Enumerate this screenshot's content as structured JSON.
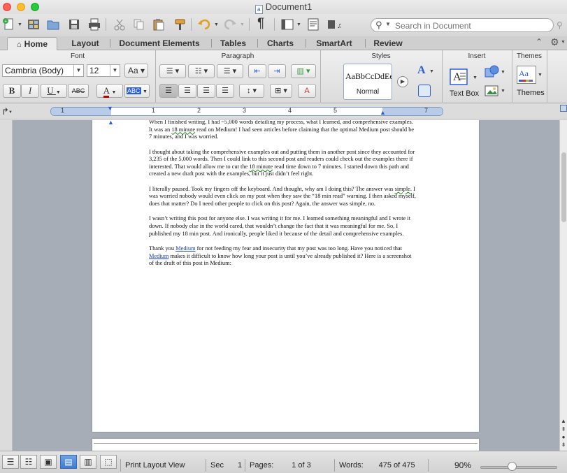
{
  "window": {
    "title": "Document1"
  },
  "search": {
    "placeholder": "Search in Document"
  },
  "tabs": [
    "Home",
    "Layout",
    "Document Elements",
    "Tables",
    "Charts",
    "SmartArt",
    "Review"
  ],
  "groups": {
    "font": "Font",
    "paragraph": "Paragraph",
    "styles": "Styles",
    "insert": "Insert",
    "themes": "Themes"
  },
  "font": {
    "family": "Cambria (Body)",
    "size": "12",
    "bold": "B",
    "italic": "I",
    "underline": "U",
    "strike": "ABC"
  },
  "styles": {
    "sample": "AaBbCcDdEe",
    "current": "Normal"
  },
  "insert": {
    "textbox_label": "Text Box"
  },
  "themes": {
    "label": "Themes",
    "sample": "Aa"
  },
  "ruler": {
    "numbers": [
      "1",
      "1",
      "2",
      "3",
      "4",
      "5",
      "7"
    ]
  },
  "document": {
    "paragraphs": [
      {
        "segments": [
          {
            "text": "When I finished writing, I had ~5,000 words detailing my process, what I learned, and comprehensive examples. It was an "
          },
          {
            "text": "18 minute",
            "style": "sq"
          },
          {
            "text": " read on Medium! I had seen articles before claiming that the optimal Medium post should be 7 minutes, and I was worried."
          }
        ]
      },
      {
        "segments": [
          {
            "text": "I thought about taking the comprehensive examples out and putting them in another post since they accounted for 3,235 of the 5,000 words. Then I could link to this second post and readers could check out the examples there if interested. That would allow me to cut the "
          },
          {
            "text": "18 minute",
            "style": "sq"
          },
          {
            "text": " read time down to 7 minutes. I started down this path and created a new draft post with the examples, but it just didn’t feel right."
          }
        ]
      },
      {
        "segments": [
          {
            "text": "I literally paused. Took my fingers off the keyboard. And thought, why am I doing this? The answer was "
          },
          {
            "text": "simple.",
            "style": "sq"
          },
          {
            "text": " I was worried nobody would even click on my post when they saw the “18 min read” warning. I then asked myself, does that matter? Do I need other people to click on this post? Again, the answer was simple, no."
          }
        ]
      },
      {
        "segments": [
          {
            "text": "I wasn’t writing this post for anyone else. I was writing it for me. I learned something meaningful and I wrote it down. If nobody else in the world cared, that wouldn’t change the fact that it was meaningful for me. So, I published my 18 min post. And ironically, people liked it because of the detail and comprehensive examples."
          }
        ]
      },
      {
        "segments": [
          {
            "text": "Thank you "
          },
          {
            "text": "Medium",
            "style": "lnk"
          },
          {
            "text": " for not feeding my fear and insecurity that my post was too long. Have you noticed that "
          },
          {
            "text": "Medium",
            "style": "lnk"
          },
          {
            "text": " makes it difficult to know how long your post is until you’ve already published it? Here is a screenshot of the draft of this post in Medium:"
          }
        ]
      }
    ]
  },
  "status": {
    "view": "Print Layout View",
    "sec_label": "Sec",
    "sec_value": "1",
    "pages_label": "Pages:",
    "pages_value": "1 of 3",
    "words_label": "Words:",
    "words_value": "475 of 475",
    "zoom": "90%"
  },
  "icons": {
    "para_mark": "¶",
    "play": "▶",
    "dropdown": "▼"
  }
}
